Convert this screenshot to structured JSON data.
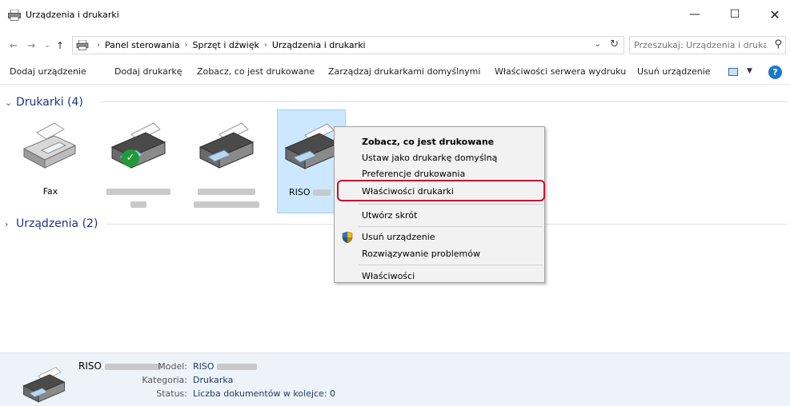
{
  "window": {
    "title": "Urządzenia i drukarki",
    "minimize_glyph": "—",
    "maximize_glyph": "☐",
    "close_glyph": "✕"
  },
  "address": {
    "crumbs": [
      "Panel sterowania",
      "Sprzęt i dźwięk",
      "Urządzenia i drukarki"
    ],
    "search_placeholder": "Przeszukaj: Urządzenia i druka..."
  },
  "toolbar": {
    "items": [
      "Dodaj urządzenie",
      "Dodaj drukarkę",
      "Zobacz, co jest drukowane",
      "Zarządzaj drukarkami domyślnymi",
      "Właściwości serwera wydruku",
      "Usuń urządzenie"
    ],
    "help_glyph": "?"
  },
  "groups": {
    "printers": "Drukarki (4)",
    "devices": "Urządzenia (2)"
  },
  "devices": [
    {
      "label": "Fax",
      "default": false,
      "selected": false
    },
    {
      "label": "",
      "default": true,
      "selected": false
    },
    {
      "label": "",
      "default": false,
      "selected": false
    },
    {
      "label": "RISO",
      "default": false,
      "selected": true
    }
  ],
  "context_menu": {
    "items": [
      "Zobacz, co jest drukowane",
      "Ustaw jako drukarkę domyślną",
      "Preferencje drukowania",
      "Właściwości drukarki",
      "Utwórz skrót",
      "Usuń urządzenie",
      "Rozwiązywanie problemów",
      "Właściwości"
    ],
    "highlight_color": "#c8102e"
  },
  "details": {
    "name": "RISO",
    "model_label": "Model:",
    "model_value": "RISO",
    "category_label": "Kategoria:",
    "category_value": "Drukarka",
    "status_label": "Status:",
    "status_value": "Liczba dokumentów w kolejce: 0"
  }
}
